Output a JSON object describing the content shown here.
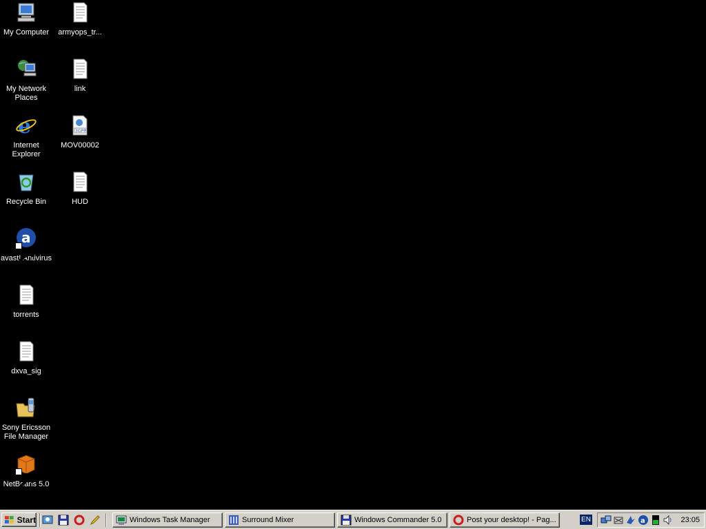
{
  "desktop": {
    "icons": [
      {
        "label": "My Computer"
      },
      {
        "label": "My Network Places"
      },
      {
        "label": "Internet Explorer"
      },
      {
        "label": "Recycle Bin"
      },
      {
        "label": "avast! Antivirus"
      },
      {
        "label": "torrents"
      },
      {
        "label": "dxva_sig"
      },
      {
        "label": "Sony Ericsson File Manager"
      },
      {
        "label": "NetBeans 5.0"
      },
      {
        "label": "armyops_tr..."
      },
      {
        "label": "link"
      },
      {
        "label": "MOV00002"
      },
      {
        "label": "HUD"
      }
    ],
    "file_badge_3gpp": "3GPP"
  },
  "taskbar": {
    "start_label": "Start",
    "tasks": [
      {
        "label": "Windows Task Manager"
      },
      {
        "label": "Surround Mixer"
      },
      {
        "label": "Windows Commander 5.0"
      },
      {
        "label": "Post your desktop! - Pag..."
      }
    ],
    "language": "EN",
    "clock": "23:05"
  },
  "colors": {
    "desktop_bg": "#000000",
    "taskbar_bg": "#d4d0c8"
  }
}
